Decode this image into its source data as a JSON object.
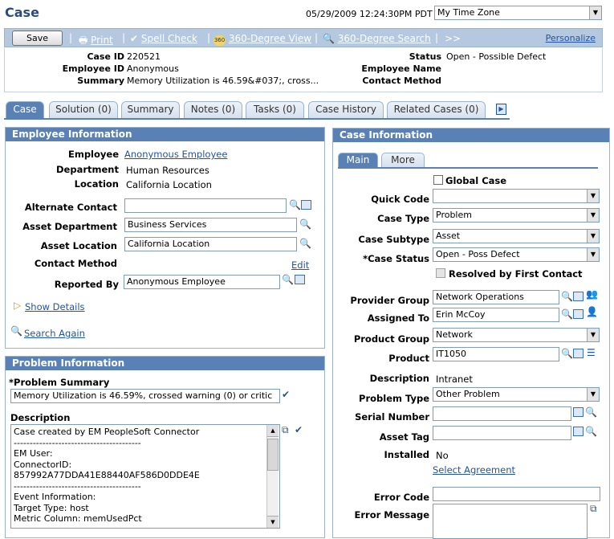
{
  "page": {
    "title": "Case",
    "datetime": "05/29/2009 12:24:30PM PDT",
    "timezone": "My Time Zone"
  },
  "toolbar": {
    "save": "Save",
    "print": "Print",
    "spell_check": "Spell Check",
    "view_360": "360-Degree View",
    "search_360": "360-Degree Search",
    "more": ">>",
    "personalize": "Personalize"
  },
  "header": {
    "case_id_label": "Case ID",
    "case_id": "220521",
    "employee_id_label": "Employee ID",
    "employee_id": "Anonymous",
    "summary_label": "Summary",
    "summary": "Memory Utilization is 46.59&#037;, cross...",
    "status_label": "Status",
    "status": "Open - Possible Defect",
    "employee_name_label": "Employee Name",
    "contact_method_label": "Contact Method"
  },
  "tabs": [
    "Case",
    "Solution (0)",
    "Summary",
    "Notes (0)",
    "Tasks (0)",
    "Case History",
    "Related Cases (0)"
  ],
  "employee_info": {
    "title": "Employee Information",
    "employee_label": "Employee",
    "employee": "Anonymous Employee",
    "department_label": "Department",
    "department": "Human Resources",
    "location_label": "Location",
    "location": "California Location",
    "alternate_contact_label": "Alternate Contact",
    "alternate_contact": "",
    "asset_department_label": "Asset Department",
    "asset_department": "Business Services",
    "asset_location_label": "Asset Location",
    "asset_location": "California Location",
    "contact_method_label": "Contact Method",
    "edit": "Edit",
    "reported_by_label": "Reported By",
    "reported_by": "Anonymous Employee",
    "show_details": "Show Details",
    "search_again": "Search Again"
  },
  "problem_info": {
    "title": "Problem Information",
    "summary_label": "*Problem Summary",
    "summary": "Memory Utilization is 46.59%, crossed warning (0) or critic",
    "description_label": "Description",
    "description_lines": [
      "Case created by EM PeopleSoft Connector",
      "----------------------------------------",
      "EM User:",
      "ConnectorID:",
      "857992A77DDA41E88440AF586D0DDE4E",
      "----------------------------------------",
      "Event Information:",
      "Target Type: host",
      "Metric Column: memUsedPct"
    ]
  },
  "case_info": {
    "title": "Case Information",
    "subtabs": [
      "Main",
      "More"
    ],
    "global_case": "Global Case",
    "quick_code_label": "Quick Code",
    "quick_code": "",
    "case_type_label": "Case Type",
    "case_type": "Problem",
    "case_subtype_label": "Case Subtype",
    "case_subtype": "Asset",
    "case_status_label": "*Case Status",
    "case_status": "Open - Poss Defect",
    "resolved_first_contact": "Resolved by First Contact",
    "provider_group_label": "Provider Group",
    "provider_group": "Network Operations",
    "assigned_to_label": "Assigned To",
    "assigned_to": "Erin McCoy",
    "product_group_label": "Product Group",
    "product_group": "Network",
    "product_label": "Product",
    "product": "IT1050",
    "description_label": "Description",
    "description": "Intranet",
    "problem_type_label": "Problem Type",
    "problem_type": "Other Problem",
    "serial_number_label": "Serial Number",
    "serial_number": "",
    "asset_tag_label": "Asset Tag",
    "asset_tag": "",
    "installed_label": "Installed",
    "installed": "No",
    "select_agreement": "Select Agreement",
    "error_code_label": "Error Code",
    "error_code": "",
    "error_message_label": "Error Message",
    "error_message": ""
  }
}
